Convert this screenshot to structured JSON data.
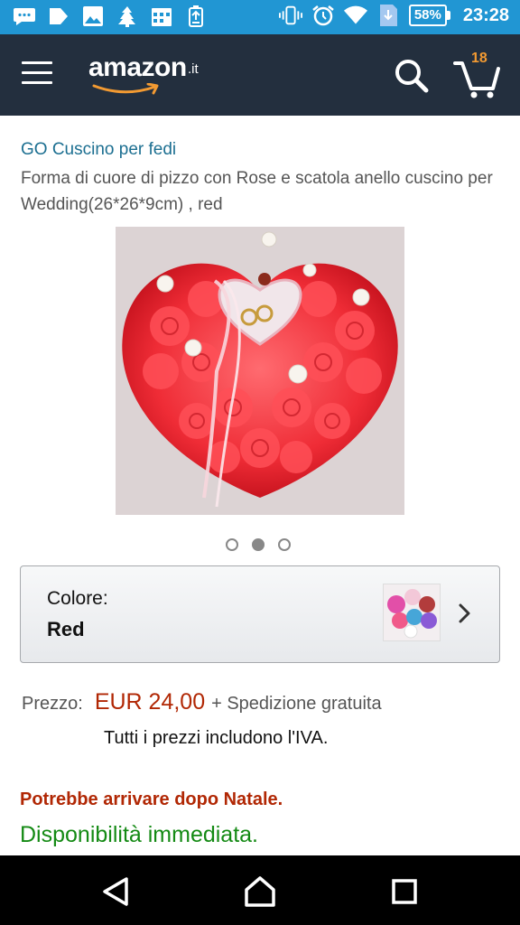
{
  "status_bar": {
    "battery": "58%",
    "time": "23:28",
    "icons": [
      "chat-icon",
      "messenger-icon",
      "image-icon",
      "tree-icon",
      "calendar-icon",
      "battery-saver-icon",
      "vibrate-icon",
      "alarm-icon",
      "wifi-icon",
      "download-icon"
    ]
  },
  "header": {
    "logo_text": "amazon",
    "logo_suffix": ".it",
    "cart_count": "18",
    "icons": [
      "menu-icon",
      "search-icon",
      "cart-icon"
    ]
  },
  "product": {
    "brand": "GO Cuscino per fedi",
    "title": "Forma di cuore di pizzo con Rose e scatola anello cuscino per Wedding(26*26*9cm) , red",
    "image_count": 3,
    "active_image": 2
  },
  "color": {
    "label": "Colore:",
    "value": "Red"
  },
  "price": {
    "label": "Prezzo:",
    "value": "EUR 24,00",
    "shipping": "+ Spedizione gratuita",
    "vat_note": "Tutti i prezzi includono l'IVA."
  },
  "delivery": {
    "note": "Potrebbe arrivare dopo Natale.",
    "availability": "Disponibilità immediata."
  },
  "colors": {
    "status_bar": "#2196d3",
    "header": "#232f3e",
    "brand_link": "#1c6f91",
    "price": "#b12704",
    "availability": "#148a14",
    "cart_count": "#f29a32"
  }
}
